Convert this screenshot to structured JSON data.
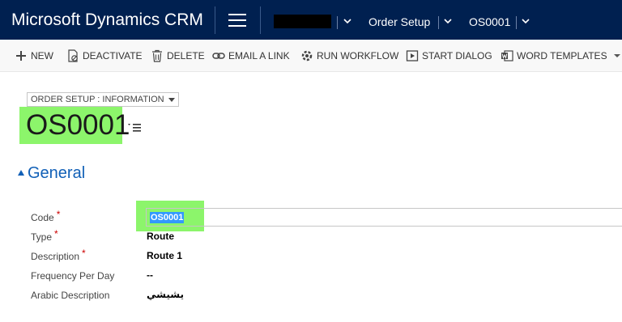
{
  "app": {
    "title": "Microsoft Dynamics CRM"
  },
  "nav": {
    "breadcrumb_entity": "Order Setup",
    "breadcrumb_record": "OS0001"
  },
  "commands": [
    {
      "label": "NEW",
      "icon": "plus-icon"
    },
    {
      "label": "DEACTIVATE",
      "icon": "deactivate-icon"
    },
    {
      "label": "DELETE",
      "icon": "trash-icon"
    },
    {
      "label": "EMAIL A LINK",
      "icon": "link-icon"
    },
    {
      "label": "RUN WORKFLOW",
      "icon": "workflow-icon"
    },
    {
      "label": "START DIALOG",
      "icon": "dialog-icon"
    },
    {
      "label": "WORD TEMPLATES",
      "icon": "word-icon"
    }
  ],
  "form": {
    "selector": "ORDER SETUP : INFORMATION",
    "record_title": "OS0001",
    "section_title": "General",
    "fields": [
      {
        "label": "Code",
        "required": "*",
        "value": "OS0001"
      },
      {
        "label": "Type",
        "required": "*",
        "value": "Route"
      },
      {
        "label": "Description",
        "required": "*",
        "value": "Route 1"
      },
      {
        "label": "Frequency Per Day",
        "required": "",
        "value": "--"
      },
      {
        "label": "Arabic Description",
        "required": "",
        "value": "يشيشي"
      }
    ]
  },
  "colors": {
    "navbar": "#002050",
    "accent": "#1160b7",
    "highlight": "#8cf56b",
    "required": "#cc0000",
    "selection": "#3399ff"
  }
}
